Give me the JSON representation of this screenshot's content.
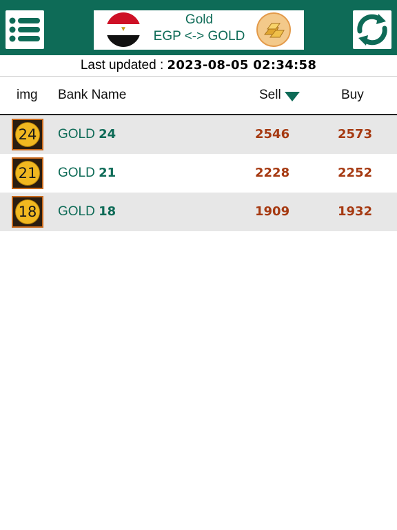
{
  "topbar": {
    "title": "Gold",
    "subtitle": "EGP <-> GOLD",
    "menu_icon": "list-icon",
    "refresh_icon": "refresh-icon",
    "flag_icon": "egypt-flag-icon",
    "gold_icon": "gold-bars-icon",
    "accent_color": "#0e6b57"
  },
  "status": {
    "label": "Last updated : ",
    "timestamp": "2023-08-05 02:34:58"
  },
  "table": {
    "columns": [
      "img",
      "Bank Name",
      "Sell",
      "Buy"
    ],
    "sort_column": "Sell",
    "sort_direction": "descending",
    "rows": [
      {
        "badge": "24",
        "name": "GOLD ",
        "karat": "24",
        "sell": "2546",
        "buy": "2573"
      },
      {
        "badge": "21",
        "name": "GOLD ",
        "karat": "21",
        "sell": "2228",
        "buy": "2252"
      },
      {
        "badge": "18",
        "name": "GOLD ",
        "karat": "18",
        "sell": "1909",
        "buy": "1932"
      }
    ]
  },
  "colors": {
    "price": "#a63a12",
    "name": "#0e6b57",
    "row_shade": "#e7e7e7"
  }
}
